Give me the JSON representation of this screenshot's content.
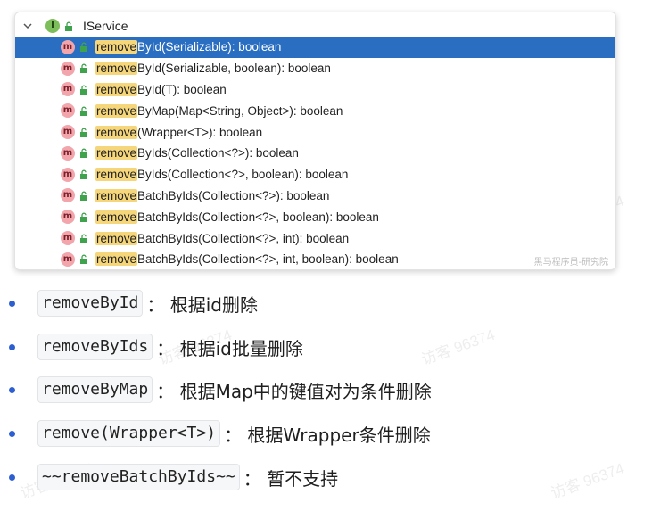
{
  "tree": {
    "interface_name": "IService",
    "interface_badge": "I",
    "method_badge": "m",
    "highlight_term": "remove",
    "selected_index": 0,
    "methods": [
      {
        "rest": "ById(Serializable): boolean"
      },
      {
        "rest": "ById(Serializable, boolean): boolean"
      },
      {
        "rest": "ById(T): boolean"
      },
      {
        "rest": "ByMap(Map<String, Object>): boolean"
      },
      {
        "rest": "(Wrapper<T>): boolean"
      },
      {
        "rest": "ByIds(Collection<?>): boolean"
      },
      {
        "rest": "ByIds(Collection<?>, boolean): boolean"
      },
      {
        "rest": "BatchByIds(Collection<?>): boolean"
      },
      {
        "rest": "BatchByIds(Collection<?>, boolean): boolean"
      },
      {
        "rest": "BatchByIds(Collection<?>, int): boolean"
      },
      {
        "rest": "BatchByIds(Collection<?>, int, boolean): boolean"
      }
    ],
    "panel_watermark": "黑马程序员-研究院"
  },
  "bullets": [
    {
      "code": "removeById",
      "desc": "： 根据id删除"
    },
    {
      "code": "removeByIds",
      "desc": "： 根据id批量删除"
    },
    {
      "code": "removeByMap",
      "desc": "： 根据Map中的键值对为条件删除"
    },
    {
      "code": "remove(Wrapper<T>)",
      "desc": "： 根据Wrapper条件删除"
    },
    {
      "code": "~~removeBatchByIds~~",
      "desc": "： 暂不支持"
    }
  ],
  "watermark_text": "访客 96374",
  "colors": {
    "selection": "#2a6ec2",
    "highlight": "#f5d67a",
    "method_badge": "#f2a6ac",
    "interface_badge": "#7cbf5a",
    "bullet_dot": "#2e5fd1"
  }
}
